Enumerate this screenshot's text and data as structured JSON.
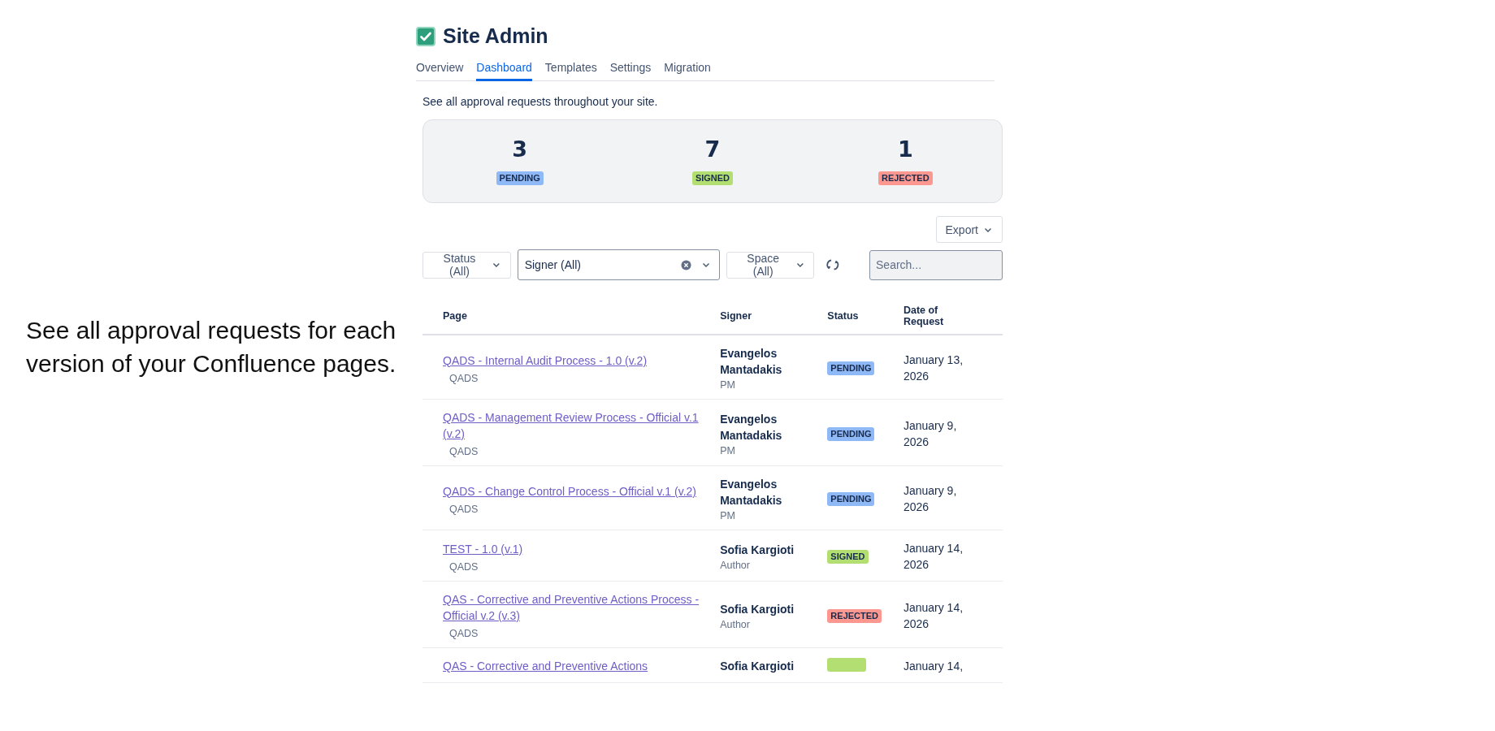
{
  "caption": "See all approval requests for each version of your Confluence pages.",
  "header": {
    "title": "Site Admin"
  },
  "tabs": [
    {
      "label": "Overview",
      "selected": false
    },
    {
      "label": "Dashboard",
      "selected": true
    },
    {
      "label": "Templates",
      "selected": false
    },
    {
      "label": "Settings",
      "selected": false
    },
    {
      "label": "Migration",
      "selected": false
    }
  ],
  "description": "See all approval requests throughout your site.",
  "stats": [
    {
      "count": "3",
      "label": "PENDING",
      "kind": "pending"
    },
    {
      "count": "7",
      "label": "SIGNED",
      "kind": "signed"
    },
    {
      "count": "1",
      "label": "REJECTED",
      "kind": "rejected"
    }
  ],
  "export_button": "Export",
  "filters": [
    {
      "label": "Status (All)",
      "kind": "dropdown"
    },
    {
      "label": "Signer (All)",
      "kind": "select"
    },
    {
      "label": "Space (All)",
      "kind": "dropdown"
    }
  ],
  "search": {
    "placeholder": "Search..."
  },
  "table": {
    "columns": [
      "Page",
      "Signer",
      "Status",
      "Date of Request"
    ],
    "rows": [
      {
        "page": "QADS - Internal Audit Process - 1.0 (v.2)",
        "space": "QADS",
        "signer": "Evangelos Mantadakis",
        "role": "PM",
        "status": {
          "kind": "pending",
          "label": "PENDING"
        },
        "date": "January 13, 2026"
      },
      {
        "page": "QADS - Management Review Process - Official v.1 (v.2)",
        "space": "QADS",
        "signer": "Evangelos Mantadakis",
        "role": "PM",
        "status": {
          "kind": "pending",
          "label": "PENDING"
        },
        "date": "January 9, 2026"
      },
      {
        "page": "QADS - Change Control Process - Official v.1 (v.2)",
        "space": "QADS",
        "signer": "Evangelos Mantadakis",
        "role": "PM",
        "status": {
          "kind": "pending",
          "label": "PENDING"
        },
        "date": "January 9, 2026"
      },
      {
        "page": "TEST - 1.0 (v.1)",
        "space": "QADS",
        "signer": "Sofia Kargioti",
        "role": "Author",
        "status": {
          "kind": "signed",
          "label": "SIGNED"
        },
        "date": "January 14, 2026"
      },
      {
        "page": "QAS - Corrective and Preventive Actions Process - Official v.2 (v.3)",
        "space": "QADS",
        "signer": "Sofia Kargioti",
        "role": "Author",
        "status": {
          "kind": "rejected",
          "label": "REJECTED"
        },
        "date": "January 14, 2026"
      },
      {
        "page": "QAS - Corrective and Preventive Actions",
        "signer": "Sofia Kargioti",
        "status": {
          "kind": "signed"
        },
        "date": "January 14,"
      }
    ]
  }
}
